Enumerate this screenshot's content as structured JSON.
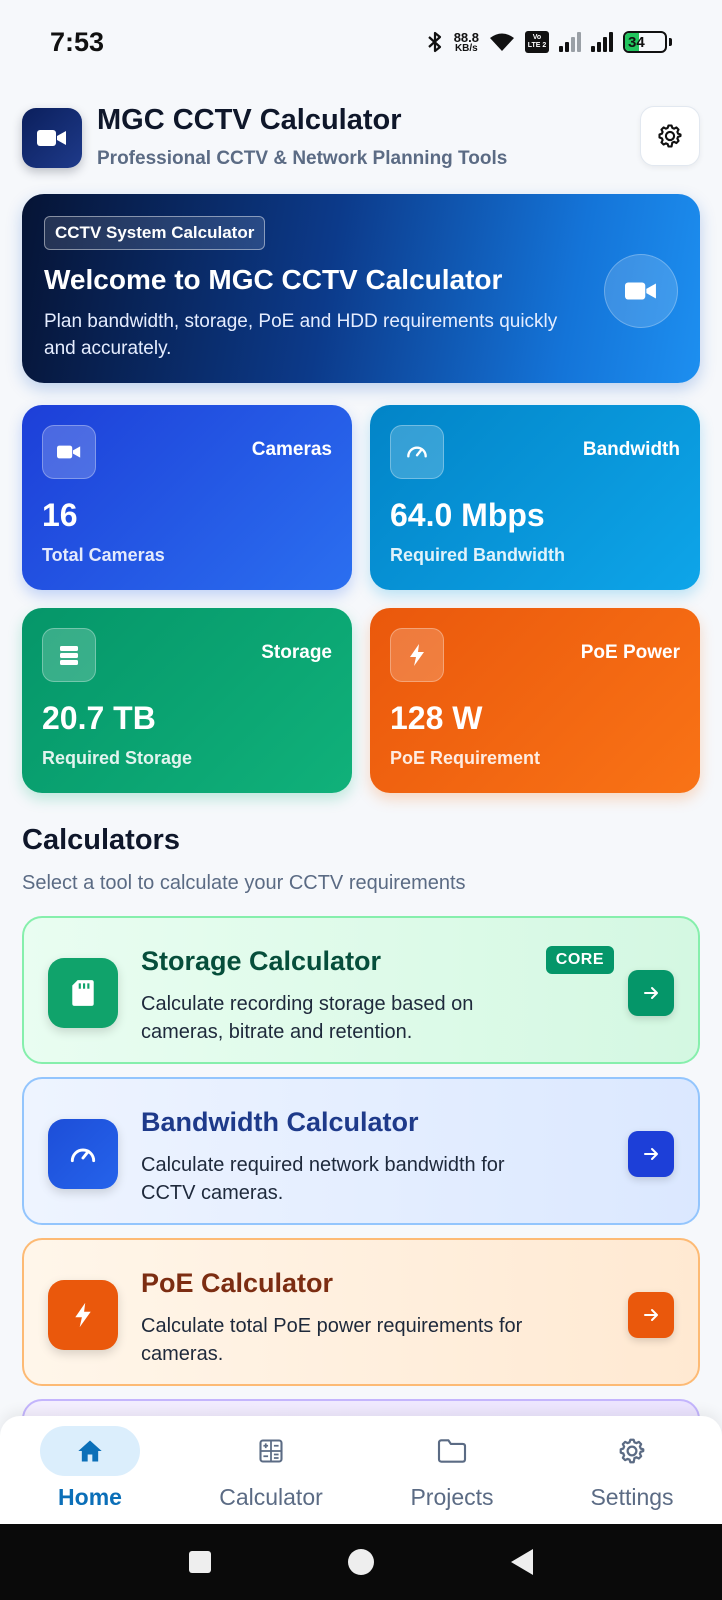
{
  "status_bar": {
    "time": "7:53",
    "net_speed_value": "88.8",
    "net_speed_unit": "KB/s",
    "volte_top": "Vo",
    "volte_bottom": "LTE 2",
    "battery": "34",
    "battery_level": 0.34
  },
  "header": {
    "title": "MGC CCTV Calculator",
    "subtitle": "Professional CCTV & Network Planning Tools"
  },
  "hero": {
    "badge": "CCTV System Calculator",
    "title": "Welcome to MGC CCTV Calculator",
    "description": "Plan bandwidth, storage, PoE and HDD requirements quickly and accurately."
  },
  "stats": {
    "cameras": {
      "label": "Cameras",
      "value": "16",
      "sub": "Total Cameras"
    },
    "bandwidth": {
      "label": "Bandwidth",
      "value": "64.0 Mbps",
      "sub": "Required Bandwidth"
    },
    "storage": {
      "label": "Storage",
      "value": "20.7 TB",
      "sub": "Required Storage"
    },
    "poe": {
      "label": "PoE Power",
      "value": "128 W",
      "sub": "PoE Requirement"
    }
  },
  "calculators": {
    "title": "Calculators",
    "subtitle": "Select a tool to calculate your CCTV requirements",
    "storage": {
      "title": "Storage Calculator",
      "badge": "CORE",
      "description": "Calculate recording storage based on cameras, bitrate and retention."
    },
    "bandwidth": {
      "title": "Bandwidth Calculator",
      "description": "Calculate required network bandwidth for CCTV cameras."
    },
    "poe": {
      "title": "PoE Calculator",
      "description": "Calculate total PoE power requirements for cameras."
    }
  },
  "nav": {
    "home": "Home",
    "calculator": "Calculator",
    "projects": "Projects",
    "settings": "Settings",
    "active": "home"
  },
  "colors": {
    "accent": "#0b6fb8",
    "storage": "#059669",
    "bandwidth": "#1d3fd8",
    "poe": "#ea580c"
  }
}
